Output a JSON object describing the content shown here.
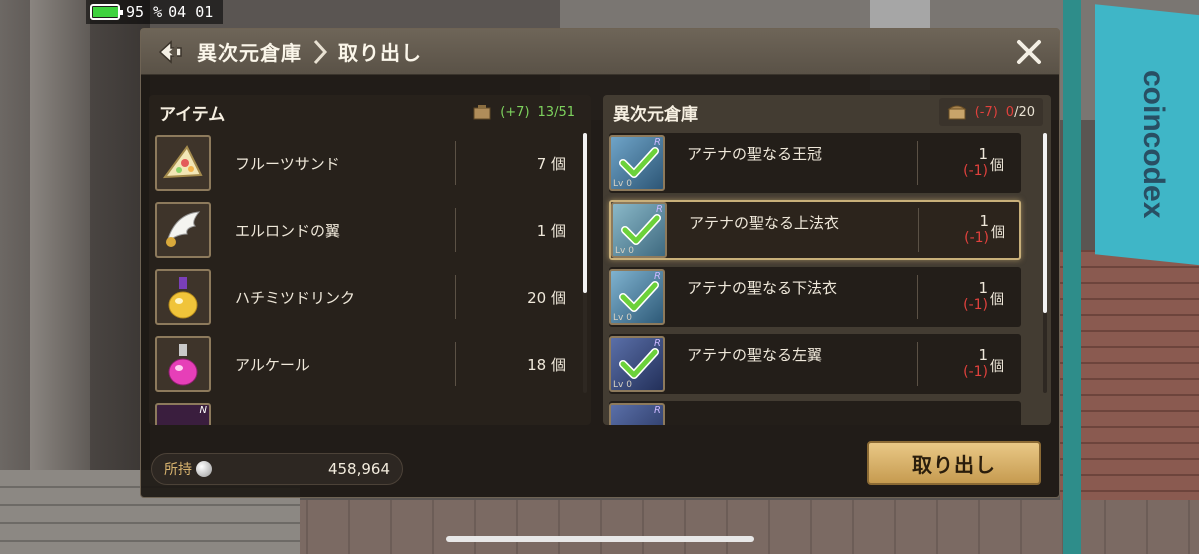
{
  "status": {
    "battery_text": "95 %",
    "battery_level": 0.95,
    "time": "04 01"
  },
  "header": {
    "title": "異次元倉庫",
    "subtitle": "取り出し"
  },
  "left_panel": {
    "title": "アイテム",
    "delta": "(+7)",
    "count": "13/51",
    "items": [
      {
        "name": "フルーツサンド",
        "qty": "7 個",
        "icon": "fruit-sandwich-icon"
      },
      {
        "name": "エルロンドの翼",
        "qty": "1 個",
        "icon": "elrond-wing-icon"
      },
      {
        "name": "ハチミツドリンク",
        "qty": "20 個",
        "icon": "honey-drink-icon"
      },
      {
        "name": "アルケール",
        "qty": "18 個",
        "icon": "alcale-potion-icon"
      }
    ],
    "partial_badge": "N"
  },
  "right_panel": {
    "title": "異次元倉庫",
    "delta": "(-7)",
    "count_zero": "0",
    "count_total": "/20",
    "items": [
      {
        "name": "アテナの聖なる王冠",
        "qty": "1",
        "unit": "個",
        "delta": "(-1)",
        "level": "Lv 0",
        "rarity": "R",
        "selected": false
      },
      {
        "name": "アテナの聖なる上法衣",
        "qty": "1",
        "unit": "個",
        "delta": "(-1)",
        "level": "Lv 0",
        "rarity": "R",
        "selected": true
      },
      {
        "name": "アテナの聖なる下法衣",
        "qty": "1",
        "unit": "個",
        "delta": "(-1)",
        "level": "Lv 0",
        "rarity": "R",
        "selected": false
      },
      {
        "name": "アテナの聖なる左翼",
        "qty": "1",
        "unit": "個",
        "delta": "(-1)",
        "level": "Lv 0",
        "rarity": "R",
        "selected": false
      }
    ],
    "partial_badge": "R"
  },
  "footer": {
    "money_label": "所持",
    "money_value": "458,964",
    "withdraw_label": "取り出し"
  },
  "background": {
    "banner_text": "coincodex"
  },
  "colors": {
    "accent_gold": "#d6b26e",
    "positive": "#7ed35e",
    "negative": "#e0413d",
    "button": "#e0bd78"
  }
}
